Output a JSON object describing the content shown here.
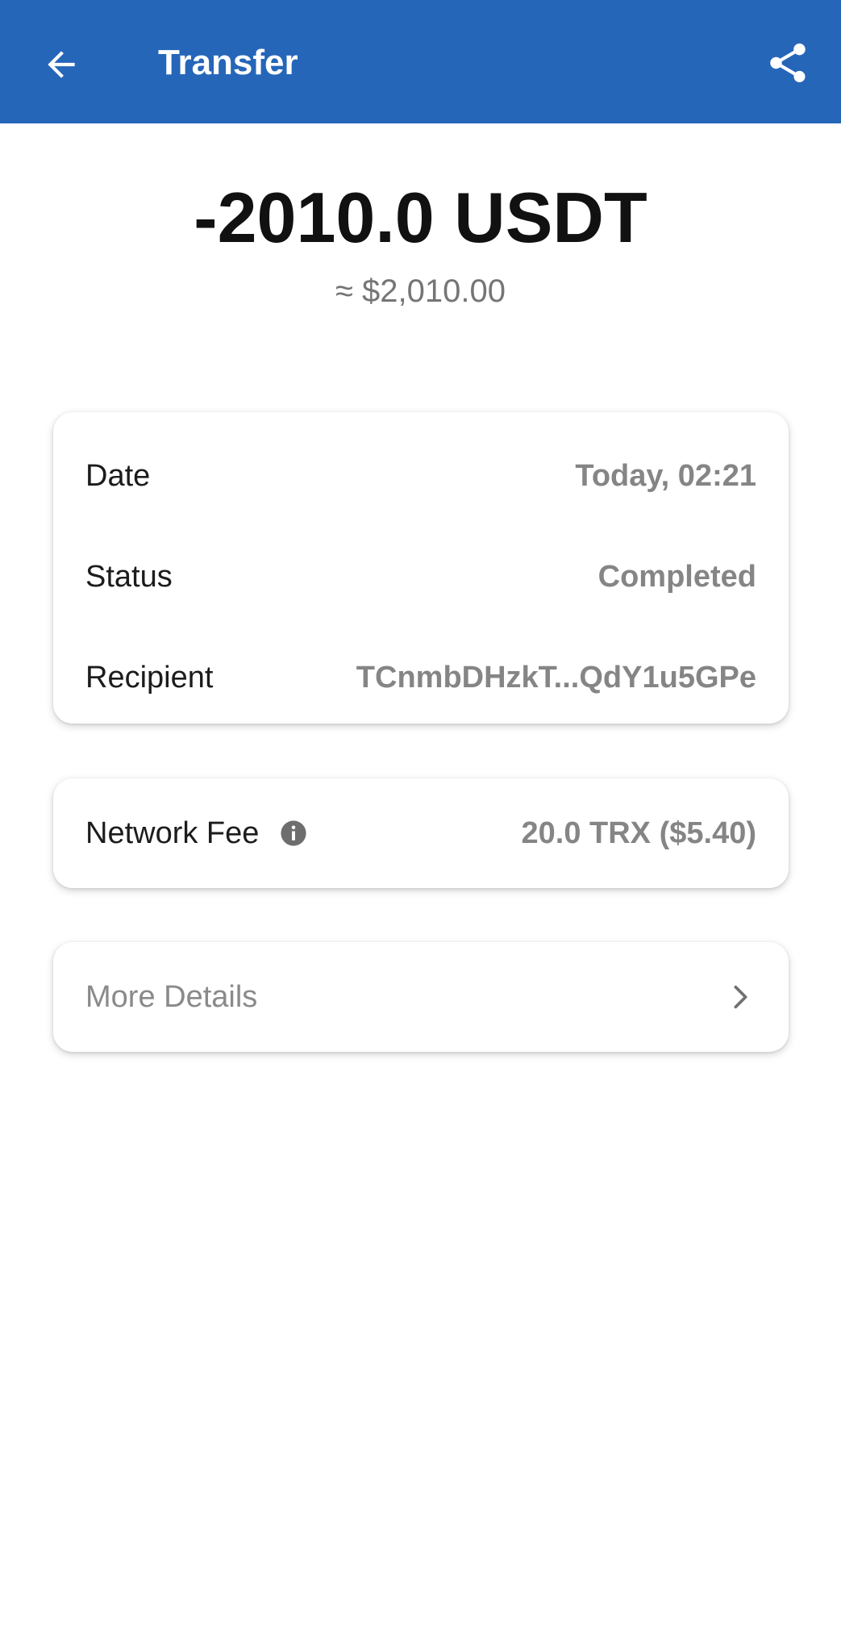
{
  "app_bar": {
    "title": "Transfer",
    "back_icon": "arrow-left-icon",
    "share_icon": "share-icon",
    "color": "#2566b9"
  },
  "amount": {
    "value": "-2010.0 USDT",
    "fiat": "≈ $2,010.00"
  },
  "details": {
    "date_label": "Date",
    "date_value": "Today, 02:21",
    "status_label": "Status",
    "status_value": "Completed",
    "recipient_label": "Recipient",
    "recipient_value": "TCnmbDHzkT...QdY1u5GPe"
  },
  "fee": {
    "label": "Network Fee",
    "info_icon": "info-icon",
    "value": "20.0 TRX ($5.40)"
  },
  "more": {
    "label": "More Details",
    "chevron_icon": "chevron-right-icon"
  }
}
